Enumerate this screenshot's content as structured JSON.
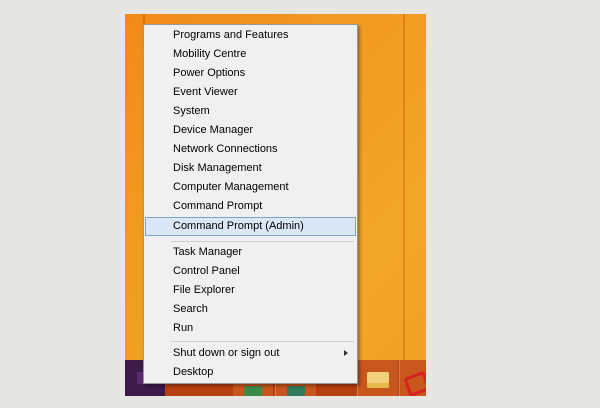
{
  "menu": {
    "items": [
      {
        "label": "Programs and Features"
      },
      {
        "label": "Mobility Centre"
      },
      {
        "label": "Power Options"
      },
      {
        "label": "Event Viewer"
      },
      {
        "label": "System"
      },
      {
        "label": "Device Manager"
      },
      {
        "label": "Network Connections"
      },
      {
        "label": "Disk Management"
      },
      {
        "label": "Computer Management"
      },
      {
        "label": "Command Prompt"
      },
      {
        "label": "Command Prompt (Admin)",
        "highlighted": true
      },
      {
        "label": "Task Manager"
      },
      {
        "label": "Control Panel"
      },
      {
        "label": "File Explorer"
      },
      {
        "label": "Search"
      },
      {
        "label": "Run"
      },
      {
        "label": "Shut down or sign out",
        "has_submenu": true
      },
      {
        "label": "Desktop"
      }
    ]
  },
  "taskbar": {
    "icons": [
      "start-icon",
      "app-icon-green",
      "folder-icon",
      "app-icon-red"
    ]
  },
  "colors": {
    "desktop": "#f29a22",
    "taskbar": "#b53f0f",
    "menu_bg": "#f0f0f0",
    "highlight_bg": "#dbe7f6",
    "highlight_border": "#7da2ce"
  }
}
